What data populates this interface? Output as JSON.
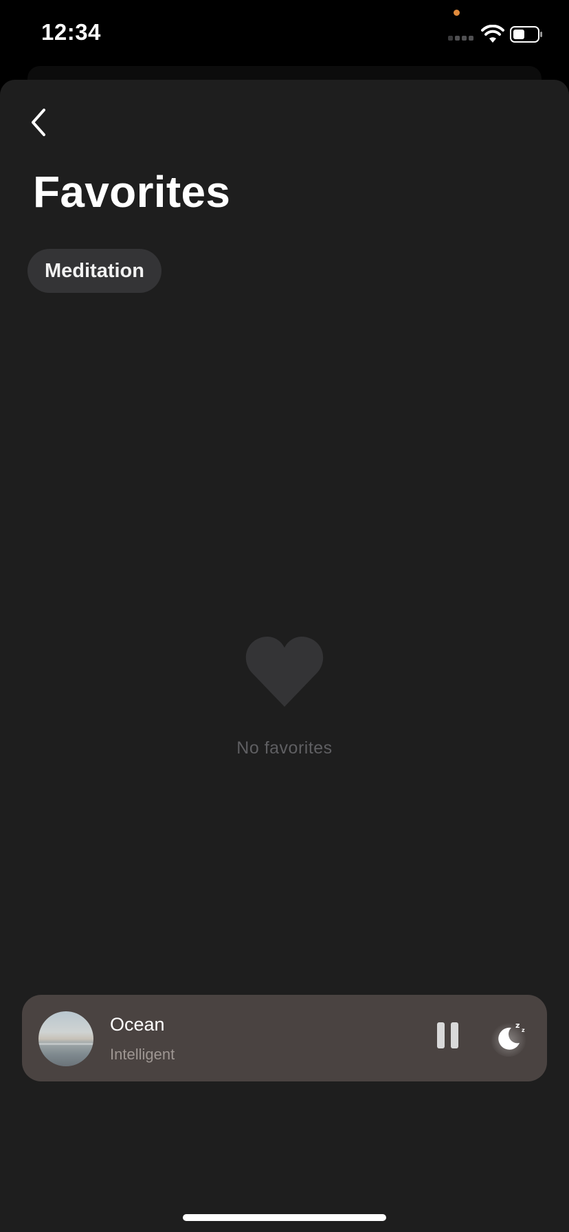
{
  "status_bar": {
    "time": "12:34"
  },
  "header": {
    "back_icon": "chevron-left-icon",
    "title": "Favorites"
  },
  "filters": {
    "chips": [
      {
        "label": "Meditation"
      }
    ]
  },
  "empty_state": {
    "icon": "heart-icon",
    "text": "No favorites"
  },
  "mini_player": {
    "title": "Ocean",
    "subtitle": "Intelligent",
    "play_state_icon": "pause-icon",
    "sleep_icon": "moon-zzz-icon"
  },
  "colors": {
    "background": "#000000",
    "sheet": "#1e1e1e",
    "chip": "#343436",
    "player": "#4a4341",
    "muted_text": "#5f5f62",
    "privacy_dot": "#e08a3c"
  }
}
